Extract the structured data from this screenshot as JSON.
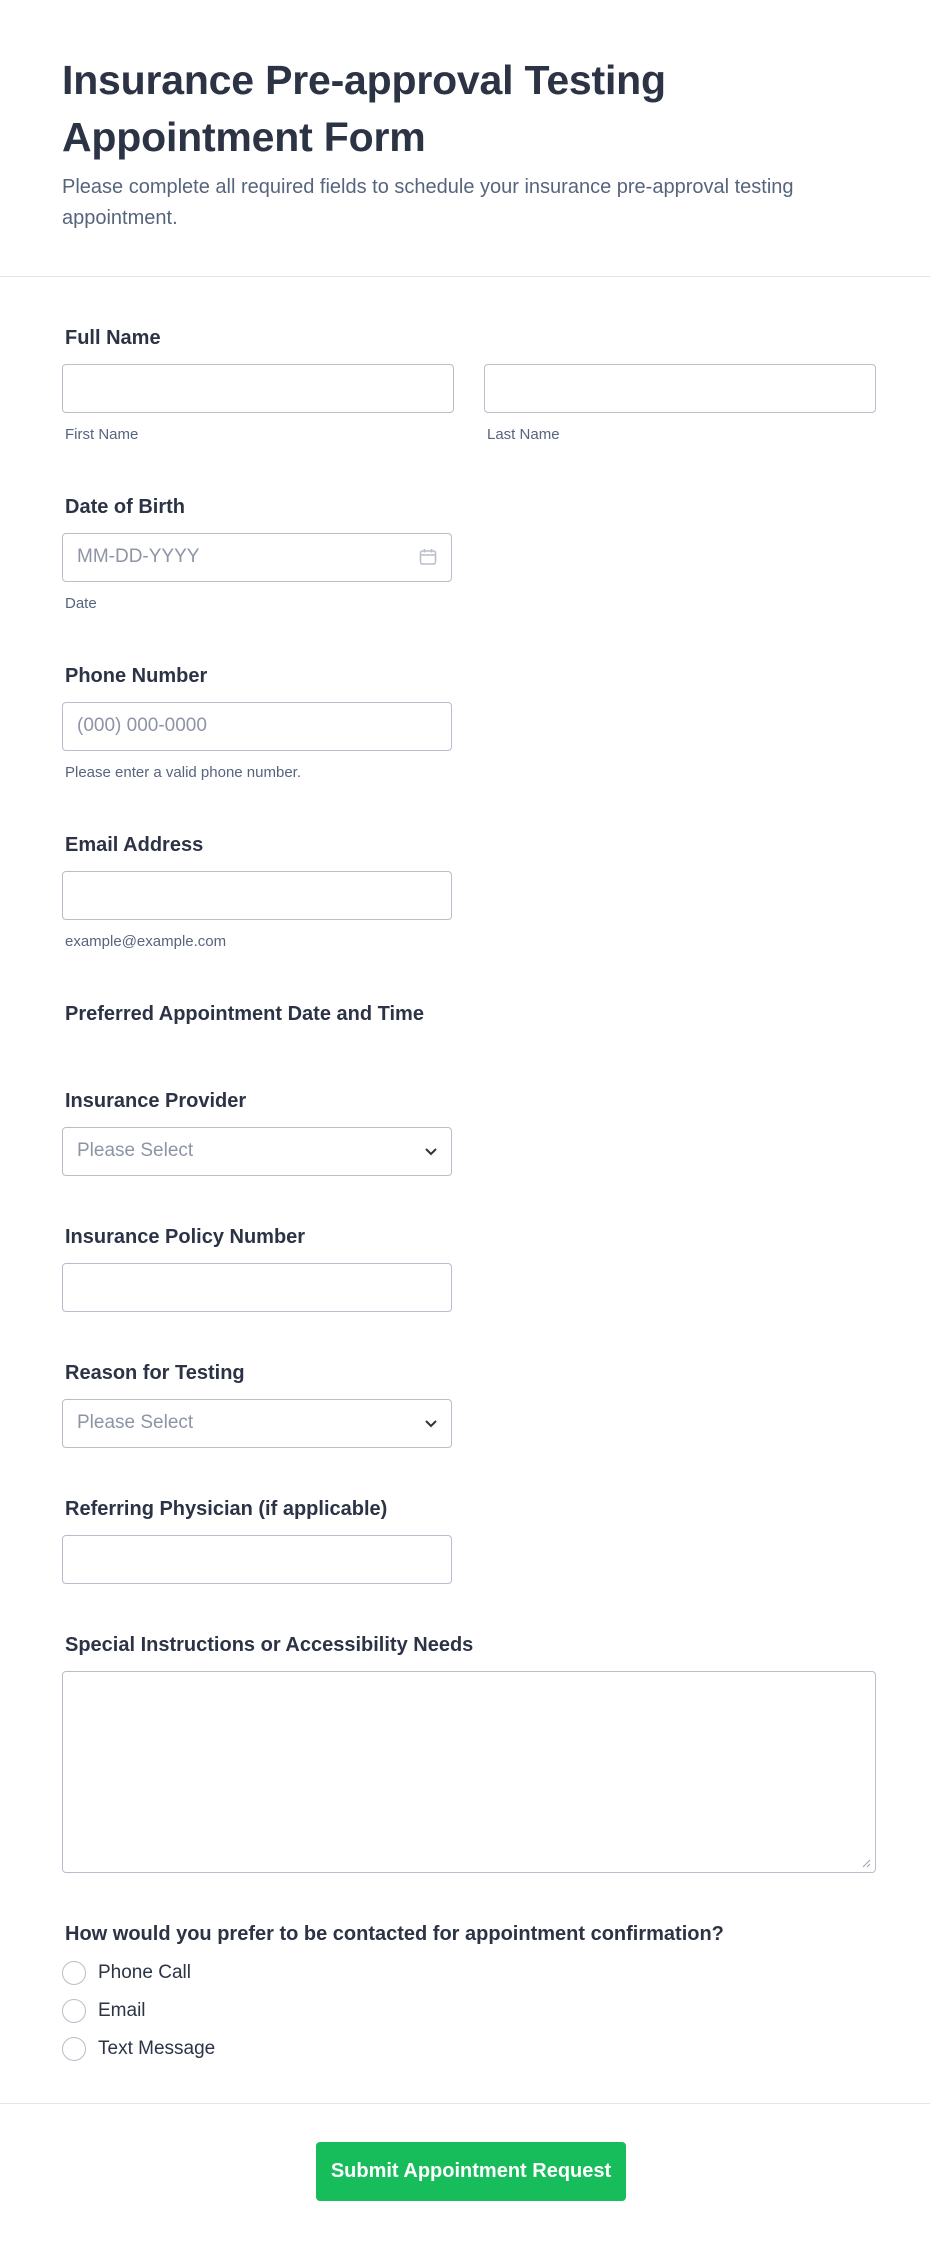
{
  "header": {
    "title": "Insurance Pre-approval Testing Appointment Form",
    "subtitle": "Please complete all required fields to schedule your insurance pre-approval testing appointment."
  },
  "full_name": {
    "label": "Full Name",
    "first_sublabel": "First Name",
    "last_sublabel": "Last Name"
  },
  "dob": {
    "label": "Date of Birth",
    "placeholder": "MM-DD-YYYY",
    "sublabel": "Date",
    "icon": "calendar-icon"
  },
  "phone": {
    "label": "Phone Number",
    "placeholder": "(000) 000-0000",
    "sublabel": "Please enter a valid phone number."
  },
  "email": {
    "label": "Email Address",
    "sublabel": "example@example.com"
  },
  "appointment": {
    "label": "Preferred Appointment Date and Time"
  },
  "insurance_provider": {
    "label": "Insurance Provider",
    "selected": "Please Select",
    "icon": "chevron-down-icon"
  },
  "policy_number": {
    "label": "Insurance Policy Number"
  },
  "reason": {
    "label": "Reason for Testing",
    "selected": "Please Select",
    "icon": "chevron-down-icon"
  },
  "physician": {
    "label": "Referring Physician (if applicable)"
  },
  "instructions": {
    "label": "Special Instructions or Accessibility Needs"
  },
  "contact": {
    "label": "How would you prefer to be contacted for appointment confirmation?",
    "options": [
      "Phone Call",
      "Email",
      "Text Message"
    ]
  },
  "submit": {
    "label": "Submit Appointment Request",
    "color": "#18bd5b"
  }
}
